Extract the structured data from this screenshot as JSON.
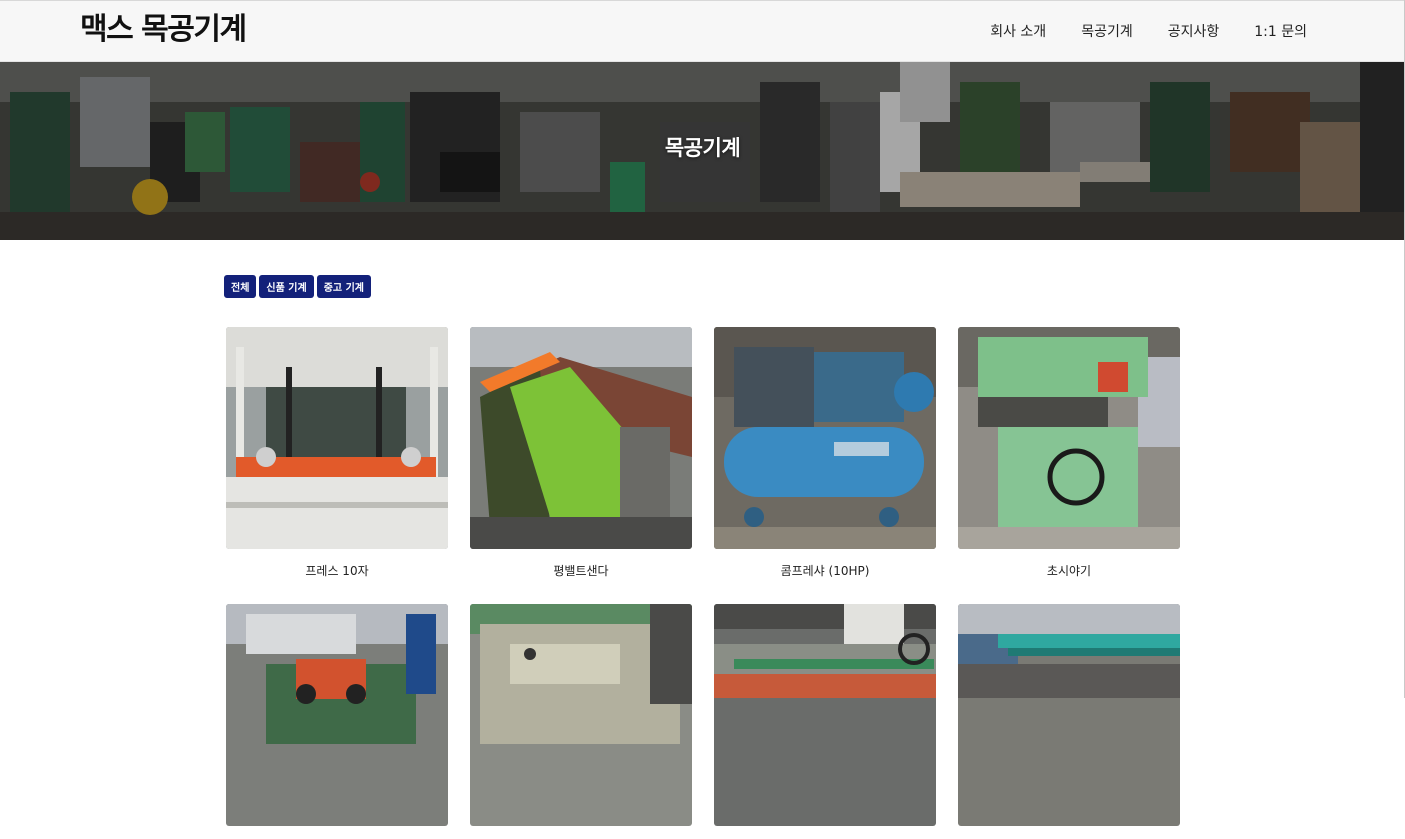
{
  "header": {
    "logo": "맥스 목공기계",
    "nav": [
      "회사 소개",
      "목공기계",
      "공지사항",
      "1:1 문의"
    ]
  },
  "hero": {
    "title": "목공기계"
  },
  "filters": [
    "전체",
    "신품 기계",
    "중고 기계"
  ],
  "products": [
    {
      "name": "프레스 10자",
      "icon": "press-machine-photo"
    },
    {
      "name": "평밸트샌다",
      "icon": "belt-sander-photo"
    },
    {
      "name": "콤프레샤 (10HP)",
      "icon": "compressor-photo"
    },
    {
      "name": "초시야기",
      "icon": "planer-photo"
    },
    {
      "name": "",
      "icon": "machine-photo"
    },
    {
      "name": "",
      "icon": "machine-photo"
    },
    {
      "name": "",
      "icon": "edge-bander-photo"
    },
    {
      "name": "",
      "icon": "machine-photo"
    }
  ],
  "colors": {
    "accent": "#13217a",
    "header_bg": "#f7f7f7"
  }
}
